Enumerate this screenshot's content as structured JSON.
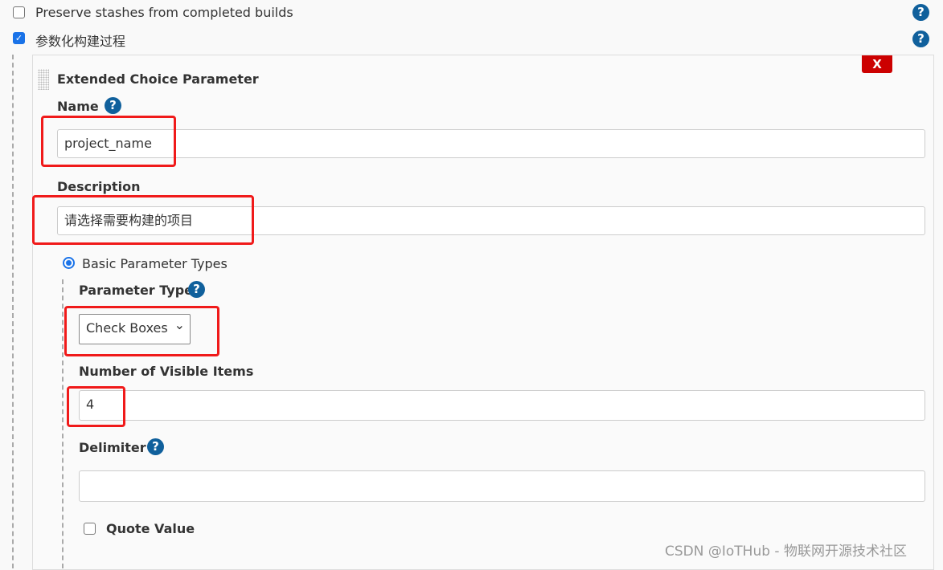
{
  "options": [
    {
      "label": "Preserve stashes from completed builds",
      "checked": false
    },
    {
      "label": "参数化构建过程",
      "checked": true
    }
  ],
  "parameter": {
    "title": "Extended Choice Parameter",
    "delete_label": "X",
    "name_label": "Name",
    "name_value": "project_name",
    "description_label": "Description",
    "description_value": "请选择需要构建的项目",
    "basic_types_label": "Basic Parameter Types",
    "parameter_type_label": "Parameter Type",
    "parameter_type_value": "Check Boxes",
    "visible_items_label": "Number of Visible Items",
    "visible_items_value": "4",
    "delimiter_label": "Delimiter",
    "delimiter_value": "",
    "quote_value_label": "Quote Value"
  },
  "icons": {
    "help": "?",
    "check": "✓",
    "chevron": "⌄"
  },
  "watermark": "CSDN @IoTHub - 物联网开源技术社区",
  "colors": {
    "help": "#10609c",
    "delete": "#cc0000",
    "highlight": "#f01a1a"
  }
}
